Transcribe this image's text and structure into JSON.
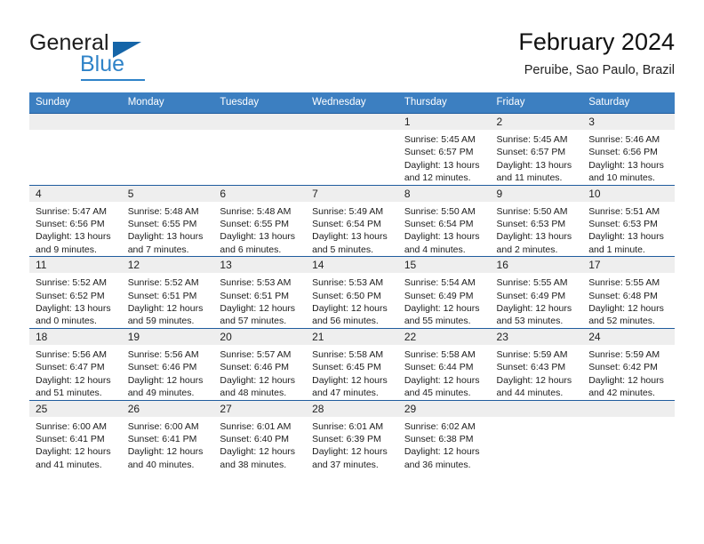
{
  "brand": {
    "name_part1": "General",
    "name_part2": "Blue",
    "triangle_icon": "triangle-icon",
    "accent_color": "#2f83c8",
    "dark_blue": "#1565a8"
  },
  "header": {
    "title": "February 2024",
    "subtitle": "Peruibe, Sao Paulo, Brazil"
  },
  "theme": {
    "header_row_bg": "#3c7fc1",
    "row_divider": "#1f5c9e",
    "daynum_band_bg": "#eeeeee",
    "text_color": "#1c1c1c"
  },
  "weekday_headers": [
    "Sunday",
    "Monday",
    "Tuesday",
    "Wednesday",
    "Thursday",
    "Friday",
    "Saturday"
  ],
  "weeks": [
    [
      {
        "day": "",
        "sunrise": "",
        "sunset": "",
        "daylight1": "",
        "daylight2": ""
      },
      {
        "day": "",
        "sunrise": "",
        "sunset": "",
        "daylight1": "",
        "daylight2": ""
      },
      {
        "day": "",
        "sunrise": "",
        "sunset": "",
        "daylight1": "",
        "daylight2": ""
      },
      {
        "day": "",
        "sunrise": "",
        "sunset": "",
        "daylight1": "",
        "daylight2": ""
      },
      {
        "day": "1",
        "sunrise": "Sunrise: 5:45 AM",
        "sunset": "Sunset: 6:57 PM",
        "daylight1": "Daylight: 13 hours",
        "daylight2": "and 12 minutes."
      },
      {
        "day": "2",
        "sunrise": "Sunrise: 5:45 AM",
        "sunset": "Sunset: 6:57 PM",
        "daylight1": "Daylight: 13 hours",
        "daylight2": "and 11 minutes."
      },
      {
        "day": "3",
        "sunrise": "Sunrise: 5:46 AM",
        "sunset": "Sunset: 6:56 PM",
        "daylight1": "Daylight: 13 hours",
        "daylight2": "and 10 minutes."
      }
    ],
    [
      {
        "day": "4",
        "sunrise": "Sunrise: 5:47 AM",
        "sunset": "Sunset: 6:56 PM",
        "daylight1": "Daylight: 13 hours",
        "daylight2": "and 9 minutes."
      },
      {
        "day": "5",
        "sunrise": "Sunrise: 5:48 AM",
        "sunset": "Sunset: 6:55 PM",
        "daylight1": "Daylight: 13 hours",
        "daylight2": "and 7 minutes."
      },
      {
        "day": "6",
        "sunrise": "Sunrise: 5:48 AM",
        "sunset": "Sunset: 6:55 PM",
        "daylight1": "Daylight: 13 hours",
        "daylight2": "and 6 minutes."
      },
      {
        "day": "7",
        "sunrise": "Sunrise: 5:49 AM",
        "sunset": "Sunset: 6:54 PM",
        "daylight1": "Daylight: 13 hours",
        "daylight2": "and 5 minutes."
      },
      {
        "day": "8",
        "sunrise": "Sunrise: 5:50 AM",
        "sunset": "Sunset: 6:54 PM",
        "daylight1": "Daylight: 13 hours",
        "daylight2": "and 4 minutes."
      },
      {
        "day": "9",
        "sunrise": "Sunrise: 5:50 AM",
        "sunset": "Sunset: 6:53 PM",
        "daylight1": "Daylight: 13 hours",
        "daylight2": "and 2 minutes."
      },
      {
        "day": "10",
        "sunrise": "Sunrise: 5:51 AM",
        "sunset": "Sunset: 6:53 PM",
        "daylight1": "Daylight: 13 hours",
        "daylight2": "and 1 minute."
      }
    ],
    [
      {
        "day": "11",
        "sunrise": "Sunrise: 5:52 AM",
        "sunset": "Sunset: 6:52 PM",
        "daylight1": "Daylight: 13 hours",
        "daylight2": "and 0 minutes."
      },
      {
        "day": "12",
        "sunrise": "Sunrise: 5:52 AM",
        "sunset": "Sunset: 6:51 PM",
        "daylight1": "Daylight: 12 hours",
        "daylight2": "and 59 minutes."
      },
      {
        "day": "13",
        "sunrise": "Sunrise: 5:53 AM",
        "sunset": "Sunset: 6:51 PM",
        "daylight1": "Daylight: 12 hours",
        "daylight2": "and 57 minutes."
      },
      {
        "day": "14",
        "sunrise": "Sunrise: 5:53 AM",
        "sunset": "Sunset: 6:50 PM",
        "daylight1": "Daylight: 12 hours",
        "daylight2": "and 56 minutes."
      },
      {
        "day": "15",
        "sunrise": "Sunrise: 5:54 AM",
        "sunset": "Sunset: 6:49 PM",
        "daylight1": "Daylight: 12 hours",
        "daylight2": "and 55 minutes."
      },
      {
        "day": "16",
        "sunrise": "Sunrise: 5:55 AM",
        "sunset": "Sunset: 6:49 PM",
        "daylight1": "Daylight: 12 hours",
        "daylight2": "and 53 minutes."
      },
      {
        "day": "17",
        "sunrise": "Sunrise: 5:55 AM",
        "sunset": "Sunset: 6:48 PM",
        "daylight1": "Daylight: 12 hours",
        "daylight2": "and 52 minutes."
      }
    ],
    [
      {
        "day": "18",
        "sunrise": "Sunrise: 5:56 AM",
        "sunset": "Sunset: 6:47 PM",
        "daylight1": "Daylight: 12 hours",
        "daylight2": "and 51 minutes."
      },
      {
        "day": "19",
        "sunrise": "Sunrise: 5:56 AM",
        "sunset": "Sunset: 6:46 PM",
        "daylight1": "Daylight: 12 hours",
        "daylight2": "and 49 minutes."
      },
      {
        "day": "20",
        "sunrise": "Sunrise: 5:57 AM",
        "sunset": "Sunset: 6:46 PM",
        "daylight1": "Daylight: 12 hours",
        "daylight2": "and 48 minutes."
      },
      {
        "day": "21",
        "sunrise": "Sunrise: 5:58 AM",
        "sunset": "Sunset: 6:45 PM",
        "daylight1": "Daylight: 12 hours",
        "daylight2": "and 47 minutes."
      },
      {
        "day": "22",
        "sunrise": "Sunrise: 5:58 AM",
        "sunset": "Sunset: 6:44 PM",
        "daylight1": "Daylight: 12 hours",
        "daylight2": "and 45 minutes."
      },
      {
        "day": "23",
        "sunrise": "Sunrise: 5:59 AM",
        "sunset": "Sunset: 6:43 PM",
        "daylight1": "Daylight: 12 hours",
        "daylight2": "and 44 minutes."
      },
      {
        "day": "24",
        "sunrise": "Sunrise: 5:59 AM",
        "sunset": "Sunset: 6:42 PM",
        "daylight1": "Daylight: 12 hours",
        "daylight2": "and 42 minutes."
      }
    ],
    [
      {
        "day": "25",
        "sunrise": "Sunrise: 6:00 AM",
        "sunset": "Sunset: 6:41 PM",
        "daylight1": "Daylight: 12 hours",
        "daylight2": "and 41 minutes."
      },
      {
        "day": "26",
        "sunrise": "Sunrise: 6:00 AM",
        "sunset": "Sunset: 6:41 PM",
        "daylight1": "Daylight: 12 hours",
        "daylight2": "and 40 minutes."
      },
      {
        "day": "27",
        "sunrise": "Sunrise: 6:01 AM",
        "sunset": "Sunset: 6:40 PM",
        "daylight1": "Daylight: 12 hours",
        "daylight2": "and 38 minutes."
      },
      {
        "day": "28",
        "sunrise": "Sunrise: 6:01 AM",
        "sunset": "Sunset: 6:39 PM",
        "daylight1": "Daylight: 12 hours",
        "daylight2": "and 37 minutes."
      },
      {
        "day": "29",
        "sunrise": "Sunrise: 6:02 AM",
        "sunset": "Sunset: 6:38 PM",
        "daylight1": "Daylight: 12 hours",
        "daylight2": "and 36 minutes."
      },
      {
        "day": "",
        "sunrise": "",
        "sunset": "",
        "daylight1": "",
        "daylight2": ""
      },
      {
        "day": "",
        "sunrise": "",
        "sunset": "",
        "daylight1": "",
        "daylight2": ""
      }
    ]
  ]
}
